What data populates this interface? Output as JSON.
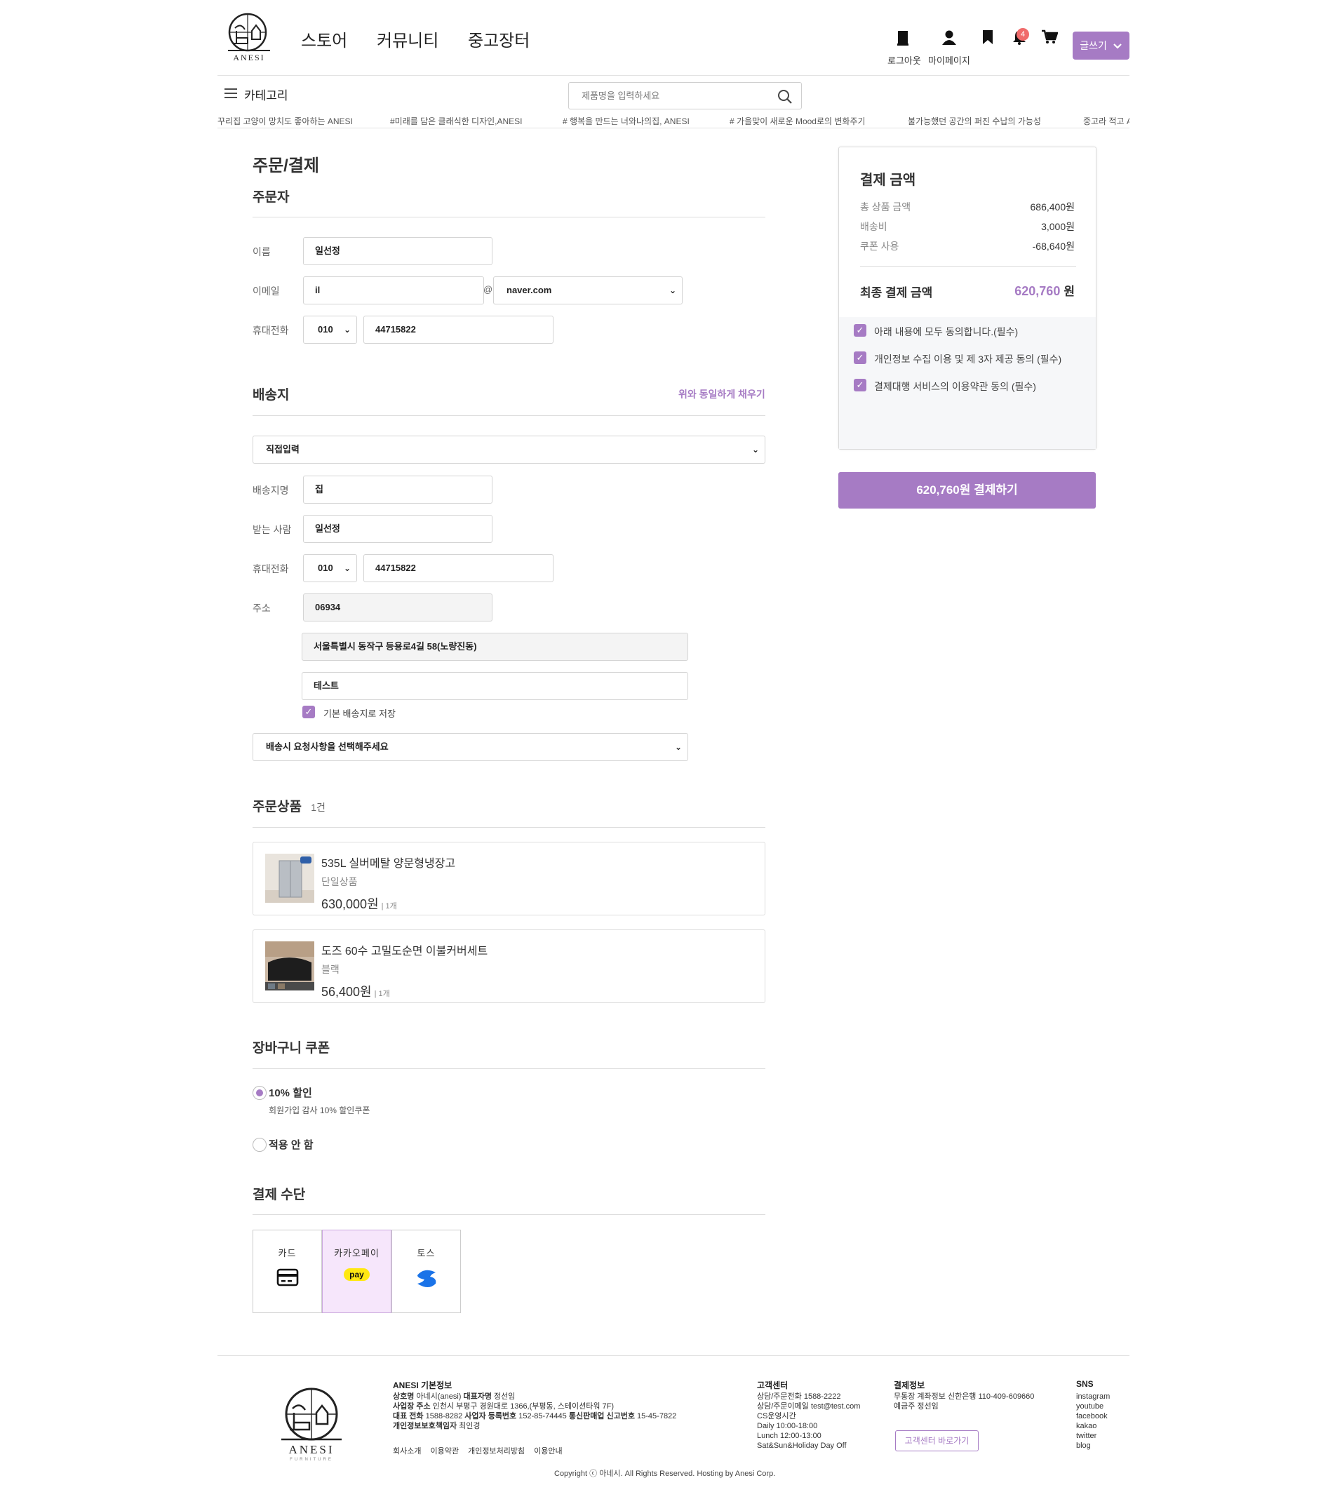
{
  "brand": {
    "name": "ANESI",
    "sub": "FURNITURE",
    "accent": "#a67bc4"
  },
  "nav": [
    {
      "label": "스토어"
    },
    {
      "label": "커뮤니티"
    },
    {
      "label": "중고장터"
    }
  ],
  "header": {
    "logout_label": "로그아웃",
    "mypage_label": "마이페이지",
    "notification_count": "4",
    "write_label": "글쓰기"
  },
  "subbar": {
    "category_label": "카테고리",
    "search_placeholder": "제품명을 입력하세요"
  },
  "ticker": [
    "꾸리집 고양이 망치도 좋아하는 ANESI",
    "#미래를 담은 클래식한 디자인,ANESI",
    "# 행복을 만드는 너와나의집, ANESI",
    "# 가을맞이 새로운 Mood로의 변화주기",
    "불가능했던 공간의 퍼진 수납의 가능성",
    "중고라 적고 A"
  ],
  "page": {
    "title": "주문/결제"
  },
  "orderer": {
    "section_title": "주문자",
    "name_label": "이름",
    "name_value": "일선정",
    "email_label": "이메일",
    "email_local": "il",
    "email_at": "@",
    "email_domain": "naver.com",
    "phone_label": "휴대전화",
    "phone_prefix": "010",
    "phone_number": "44715822"
  },
  "shipping": {
    "section_title": "배송지",
    "fill_same_label": "위와 동일하게 채우기",
    "mode": "직접입력",
    "place_label": "배송지명",
    "place_value": "집",
    "receiver_label": "받는 사람",
    "receiver_value": "일선정",
    "phone_label": "휴대전화",
    "phone_prefix": "010",
    "phone_number": "44715822",
    "address_label": "주소",
    "zipcode": "06934",
    "address1": "서울특별시 동작구 등용로4길 58(노량진동)",
    "address2": "테스트",
    "save_default_label": "기본 배송지로 저장",
    "request_placeholder": "배송시 요청사항을 선택해주세요"
  },
  "products": {
    "section_title": "주문상품",
    "count": "1건",
    "items": [
      {
        "name": "535L 실버메탈 양문형냉장고",
        "option": "단일상품",
        "price": "630,000원",
        "qty": "| 1개"
      },
      {
        "name": "도즈 60수 고밀도순면 이불커버세트",
        "option": "블랙",
        "price": "56,400원",
        "qty": "| 1개"
      }
    ]
  },
  "coupon": {
    "section_title": "장바구니 쿠폰",
    "options": [
      {
        "label": "10% 할인",
        "desc": "회원가입 감사 10% 할인쿠폰",
        "selected": true
      },
      {
        "label": "적용 안 함",
        "selected": false
      }
    ]
  },
  "payment_method": {
    "section_title": "결제 수단",
    "methods": [
      {
        "label": "카드",
        "icon": "credit-card-icon",
        "selected": false
      },
      {
        "label": "카카오페이",
        "icon": "kakaopay-icon",
        "badge": "pay",
        "selected": true
      },
      {
        "label": "토스",
        "icon": "toss-icon",
        "selected": false
      }
    ]
  },
  "summary": {
    "title": "결제 금액",
    "rows": [
      {
        "label": "총 상품 금액",
        "value": "686,400원"
      },
      {
        "label": "배송비",
        "value": "3,000원"
      },
      {
        "label": "쿠폰 사용",
        "value": "-68,640원"
      }
    ],
    "final_label": "최종 결제 금액",
    "final_value": "620,760",
    "final_unit": "원",
    "agreements": [
      "아래 내용에 모두 동의합니다.(필수)",
      "개인정보 수집 이용 및 제 3자 제공 동의 (필수)",
      "결제대행 서비스의 이용약관 동의 (필수)"
    ],
    "pay_button": "620,760원 결제하기"
  },
  "footer": {
    "info_title": "ANESI 기본정보",
    "info_lines": [
      {
        "k1": "상호명",
        "v1": "아네시(anesi)",
        "k2": "대표자명",
        "v2": "정선임"
      },
      {
        "k1": "사업장 주소",
        "v1": "인천시 부평구 경원대로 1366,(부평동, 스테이션타워 7F)"
      },
      {
        "k1": "대표 전화",
        "v1": "1588-8282",
        "k2": "사업자 등록번호",
        "v2": "152-85-74445",
        "k3": "통신판매업 신고번호",
        "v3": "15-45-7822"
      },
      {
        "k1": "개인정보보호책임자",
        "v1": "최인경"
      }
    ],
    "links": [
      "회사소개",
      "이용약관",
      "개인정보처리방침",
      "이용안내"
    ],
    "cs_title": "고객센터",
    "cs_lines": [
      "상담/주문전화 1588-2222",
      "상담/주문이메일 test@test.com",
      "CS운영시간",
      "Daily 10:00-18:00",
      "Lunch 12:00-13:00",
      "Sat&Sun&Holiday Day Off"
    ],
    "pay_title": "결제정보",
    "pay_lines": [
      "무통장 계좌정보 신한은행 110-409-609660",
      "예금주 정선임"
    ],
    "cs_button": "고객센터 바로가기",
    "sns_title": "SNS",
    "sns": [
      "instagram",
      "youtube",
      "facebook",
      "kakao",
      "twitter",
      "blog"
    ],
    "copyright": "Copyright ⓒ 아네시. All Rights Reserved. Hosting by Anesi Corp."
  }
}
